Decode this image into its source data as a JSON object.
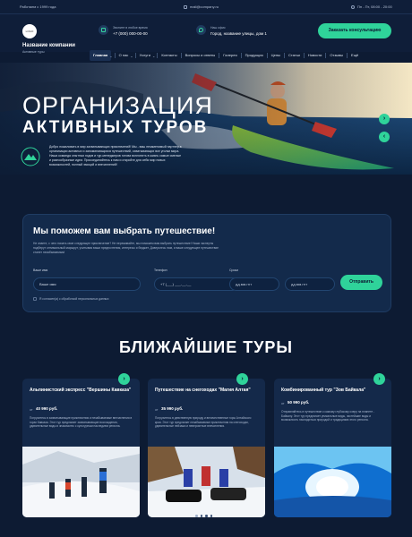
{
  "topbar": {
    "since": "Работаем с 1999 года",
    "email": "mail@company.ru",
    "hours": "Пн - Пт, 08:00 - 20:00"
  },
  "header": {
    "logo_text": "LOGO",
    "company_name": "Название компании",
    "company_sub": "Активные туры",
    "phone_label": "Звоните в любое время",
    "phone": "+7 (000) 000-00-00",
    "address_label": "Наш офис",
    "address": "Город, название улицы, дом 1",
    "consult_button": "Заказать консультацию"
  },
  "nav": {
    "items": [
      "Главная",
      "О нас",
      "Услуги",
      "Контакты",
      "Вопросы и ответы",
      "Галерея",
      "Продукция",
      "Цены",
      "Статьи",
      "Новости",
      "Отзывы",
      "Ещё"
    ]
  },
  "hero": {
    "title_line1": "ОРГАНИЗАЦИЯ",
    "title_line2": "АКТИВНЫХ ТУРОВ",
    "description": "Добро пожаловать в мир захватывающих приключений! Мы - ваш незаменимый партнер в организации активных и запоминающихся путешествий, охватывающих все уголки мира. Наша команда опытных гидов и тур-менеджеров готова воплотить в жизнь самые смелые и разнообразные идеи. Присоединяйтесь к нам и откройте для себя мир новых возможностей, полный эмоций и впечатлений!"
  },
  "form": {
    "title": "Мы поможем вам выбрать путешествие!",
    "description": "Не знаете, с чего начать свое следующее приключение? Не переживайте, мы поможем вам выбрать путешествие! Наши эксперты подберут оптимальный маршрут, учитывая ваши предпочтения, интересы и бюджет. Доверьтесь нам, и ваше следующее путешествие станет незабываемым!",
    "name_label": "Ваше имя",
    "name_placeholder": "Ваше имя",
    "phone_label": "Телефон",
    "phone_placeholder": "+7 (___) ___-__-__",
    "dates_label": "Сроки",
    "date_from_placeholder": "дд.мм.гггг",
    "date_to_placeholder": "дд.мм.гггг",
    "submit": "Отправить",
    "consent": "Я согласен(а) с обработкой персональных данных"
  },
  "tours": {
    "section_title": "БЛИЖАЙШИЕ ТУРЫ",
    "items": [
      {
        "title": "Альпинистский экспресс \"Вершины Кавказа\"",
        "from": "от",
        "price": "40 990 руб.",
        "description": "Погрузитесь в захватывающие приключения и незабываемые впечатления в горах Кавказа. Этот тур предлагает захватывающие восхождения, удивительные виды и знакомство с культурным наследием региона."
      },
      {
        "title": "Путешествие на снегоходах \"Магия Алтая\"",
        "from": "от",
        "price": "35 990 руб.",
        "description": "Погрузитесь в девственную природу и величественные горы Алтайского края. Этот тур предлагает незабываемые приключения на снегоходах, удивительные пейзажи и невероятные впечатления."
      },
      {
        "title": "Комбинированный тур \"Зов Байкала\"",
        "from": "от",
        "price": "50 990 руб.",
        "description": "Отправляйтесь в путешествие к самому глубокому озеру на планете - Байкалу. Этот тур предлагает уникальные виды, чистейшие воды и возможность насладиться природой и традициями этого региона."
      }
    ]
  },
  "colors": {
    "accent": "#2fd39a",
    "background": "#0d1b33",
    "card": "#14294a"
  }
}
